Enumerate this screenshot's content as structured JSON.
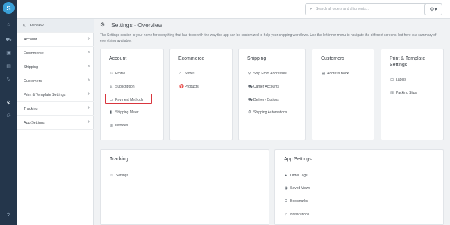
{
  "topbar": {
    "search_placeholder": "Search all orders and shipments...",
    "search_icon": "search-icon",
    "settings_icon": "gear-icon"
  },
  "sidebar": {
    "items": [
      {
        "label": "Overview",
        "icon": "overview-icon"
      },
      {
        "label": "Account"
      },
      {
        "label": "Ecommerce"
      },
      {
        "label": "Shipping"
      },
      {
        "label": "Customers"
      },
      {
        "label": "Print & Template Settings"
      },
      {
        "label": "Tracking"
      },
      {
        "label": "App Settings"
      }
    ]
  },
  "page": {
    "title": "Settings - Overview",
    "description": "The Settings section is your home for everything that has to do with the way the app can be customized to help your shipping workflows. Use the left inner menu to navigate the different screens, but here is a summary of everything available:"
  },
  "cards": [
    {
      "title": "Account",
      "links": [
        "Profile",
        "Subscription",
        "Payment Methods",
        "Shipping Meter",
        "Invoices"
      ]
    },
    {
      "title": "Ecommerce",
      "links": [
        "Stores",
        "Products"
      ]
    },
    {
      "title": "Shipping",
      "links": [
        "Ship From Addresses",
        "Carrier Accounts",
        "Delivery Options",
        "Shipping Automations"
      ]
    },
    {
      "title": "Customers",
      "links": [
        "Address Book"
      ]
    },
    {
      "title": "Print & Template Settings",
      "links": [
        "Labels",
        "Packing Slips"
      ]
    }
  ],
  "cards2": [
    {
      "title": "Tracking",
      "links": [
        "Settings"
      ]
    },
    {
      "title": "App Settings",
      "links": [
        "Order Tags",
        "Saved Views",
        "Bookmarks",
        "Notifications"
      ]
    }
  ],
  "colors": {
    "rail": "#24364b",
    "accent": "#3aa0d8",
    "highlight_border": "#d9363e"
  }
}
